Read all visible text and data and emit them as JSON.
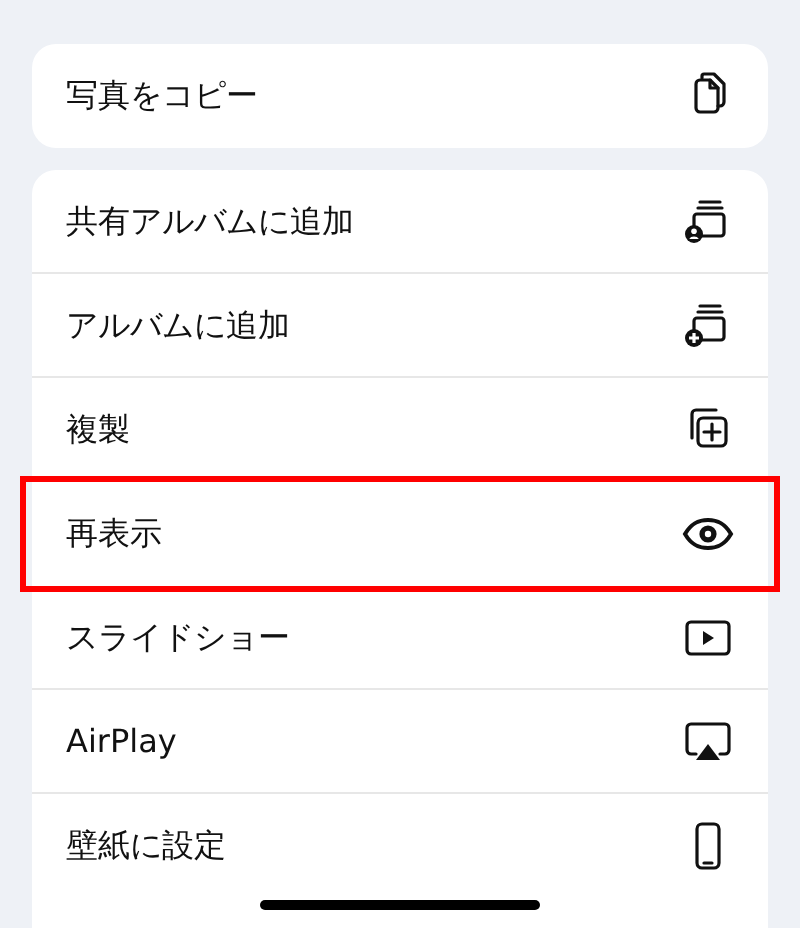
{
  "menu_groups": [
    {
      "items": [
        {
          "label": "写真をコピー",
          "kind": "copy",
          "highlighted": false
        }
      ]
    },
    {
      "items": [
        {
          "label": "共有アルバムに追加",
          "kind": "shared-album",
          "highlighted": false
        },
        {
          "label": "アルバムに追加",
          "kind": "add-album",
          "highlighted": false
        },
        {
          "label": "複製",
          "kind": "duplicate",
          "highlighted": false
        },
        {
          "label": "再表示",
          "kind": "eye",
          "highlighted": true
        },
        {
          "label": "スライドショー",
          "kind": "slideshow",
          "highlighted": false
        },
        {
          "label": "AirPlay",
          "kind": "airplay",
          "highlighted": false
        },
        {
          "label": "壁紙に設定",
          "kind": "phone",
          "highlighted": false
        }
      ]
    }
  ]
}
